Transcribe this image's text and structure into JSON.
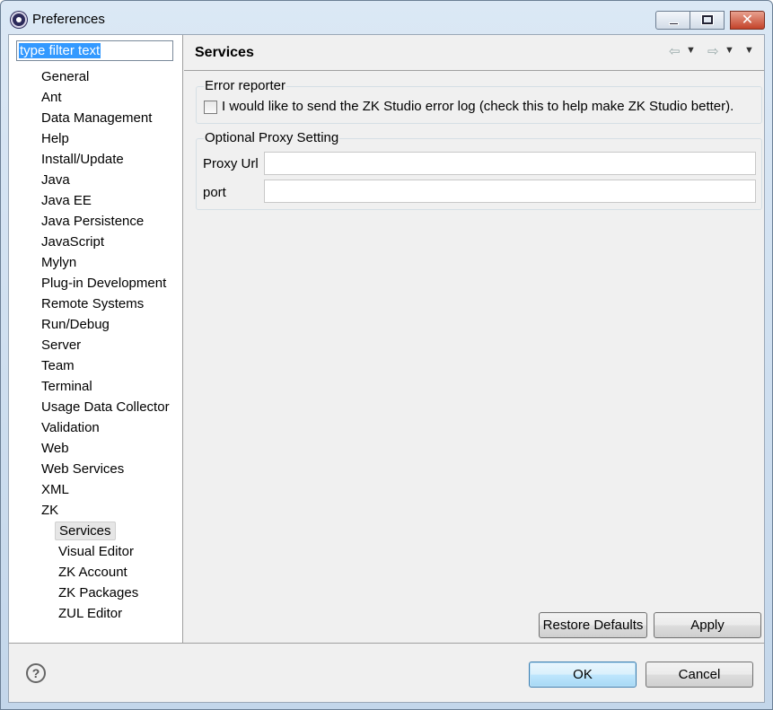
{
  "window": {
    "title": "Preferences",
    "app_icon": "eclipse-icon",
    "controls": {
      "minimize": "minimize-icon",
      "maximize": "maximize-icon",
      "close": "✕"
    }
  },
  "sidebar": {
    "filter_text": "type filter text",
    "items": [
      {
        "label": "General"
      },
      {
        "label": "Ant"
      },
      {
        "label": "Data Management"
      },
      {
        "label": "Help"
      },
      {
        "label": "Install/Update"
      },
      {
        "label": "Java"
      },
      {
        "label": "Java EE"
      },
      {
        "label": "Java Persistence"
      },
      {
        "label": "JavaScript"
      },
      {
        "label": "Mylyn"
      },
      {
        "label": "Plug-in Development"
      },
      {
        "label": "Remote Systems"
      },
      {
        "label": "Run/Debug"
      },
      {
        "label": "Server"
      },
      {
        "label": "Team"
      },
      {
        "label": "Terminal"
      },
      {
        "label": "Usage Data Collector"
      },
      {
        "label": "Validation"
      },
      {
        "label": "Web"
      },
      {
        "label": "Web Services"
      },
      {
        "label": "XML"
      },
      {
        "label": "ZK"
      }
    ],
    "zk_children": [
      {
        "label": "Services",
        "selected": true
      },
      {
        "label": "Visual Editor"
      },
      {
        "label": "ZK Account"
      },
      {
        "label": "ZK Packages"
      },
      {
        "label": "ZUL Editor"
      }
    ]
  },
  "page": {
    "title": "Services",
    "nav_icons": {
      "back": "⇦",
      "back_menu": "▼",
      "forward": "⇨",
      "forward_menu": "▼",
      "view_menu": "▼"
    },
    "error_reporter": {
      "group_label": "Error reporter",
      "checkbox_label": "I would like to send the ZK Studio error log (check this to help make ZK Studio better).",
      "checked": false
    },
    "proxy": {
      "group_label": "Optional Proxy Setting",
      "url_label": "Proxy Url",
      "url_value": "",
      "port_label": "port",
      "port_value": ""
    },
    "restore_defaults_label": "Restore Defaults",
    "apply_label": "Apply"
  },
  "footer": {
    "help_icon": "?",
    "ok_label": "OK",
    "cancel_label": "Cancel"
  },
  "colors": {
    "selection": "#3399ff",
    "window_frame": "#c3d6ea",
    "close_button": "#c3432a",
    "ok_button": "#bee6fd"
  }
}
